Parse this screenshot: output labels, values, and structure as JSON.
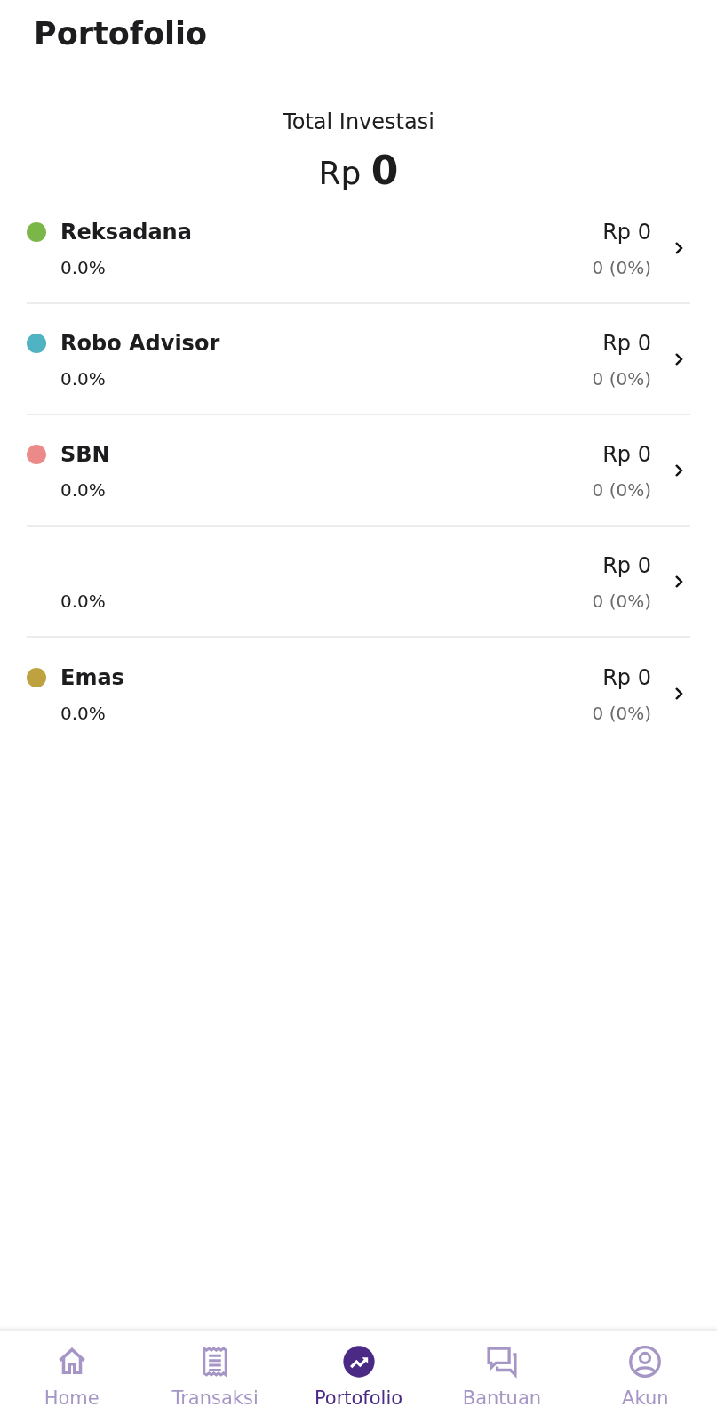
{
  "title": "Portofolio",
  "total": {
    "label": "Total Investasi",
    "amount": "Rp **0**"
  },
  "assets": [
    {
      "name": "Reksadana",
      "color": "#7ab648",
      "percent": "0.0%",
      "amount": "Rp 0",
      "change": "0 (0%)"
    },
    {
      "name": "Robo Advisor",
      "color": "#4fb3c1",
      "percent": "0.0%",
      "amount": "Rp 0",
      "change": "0 (0%)"
    },
    {
      "name": "SBN",
      "color": "#ec8a8a",
      "percent": "0.0%",
      "amount": "Rp 0",
      "change": "0 (0%)"
    },
    {
      "percent": "0.0%",
      "amount": "Rp 0",
      "change": "0 (0%)"
    },
    {
      "name": "Emas",
      "color": "#bfa240",
      "percent": "0.0%",
      "amount": "Rp 0",
      "change": "0 (0%)"
    }
  ],
  "nav": [
    {
      "kind": "home",
      "label": "Home",
      "selected": false
    },
    {
      "kind": "receipt",
      "label": "Transaksi",
      "selected": false
    },
    {
      "kind": "chart",
      "label": "Portofolio",
      "selected": true
    },
    {
      "kind": "chat",
      "label": "Bantuan",
      "selected": false
    },
    {
      "kind": "user",
      "label": "Akun",
      "selected": false
    }
  ]
}
